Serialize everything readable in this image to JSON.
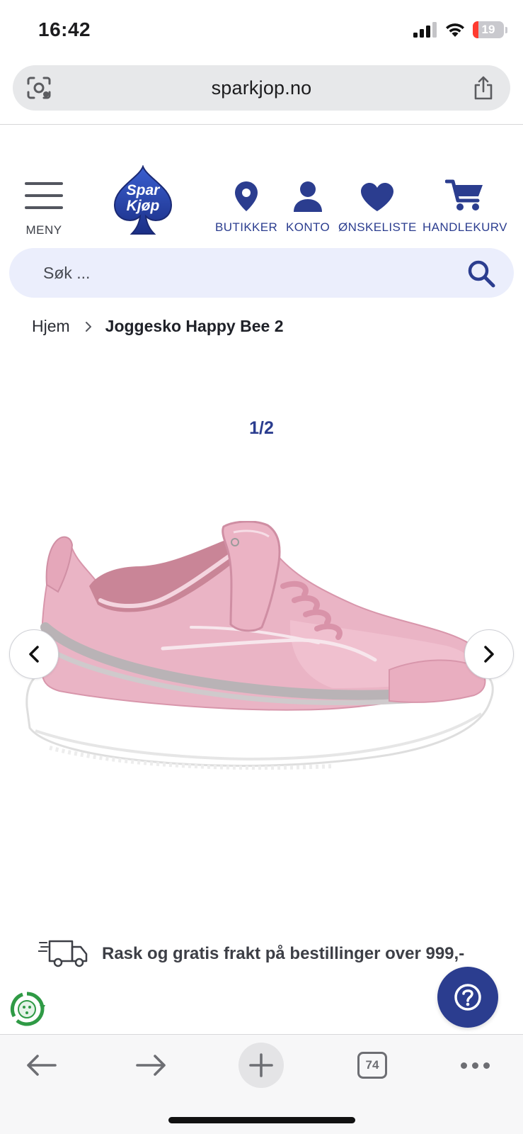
{
  "status_bar": {
    "time": "16:42",
    "battery": "19",
    "battery_level": 0.19
  },
  "browser": {
    "url": "sparkjop.no",
    "tab_count": "74"
  },
  "header": {
    "menu_label": "MENY",
    "logo_text": [
      "Spar",
      "Kjøp"
    ],
    "nav": [
      {
        "label": "BUTIKKER",
        "icon": "location-pin-icon"
      },
      {
        "label": "KONTO",
        "icon": "person-icon"
      },
      {
        "label": "ØNSKELISTE",
        "icon": "heart-icon"
      },
      {
        "label": "HANDLEKURV",
        "icon": "cart-icon"
      }
    ]
  },
  "search": {
    "placeholder": "Søk ..."
  },
  "breadcrumb": {
    "home": "Hjem",
    "current": "Joggesko Happy Bee 2"
  },
  "gallery": {
    "counter": "1/2",
    "image": "pink-velcro-sneaker"
  },
  "shipping": {
    "text": "Rask og gratis frakt på bestillinger over 999,-"
  },
  "colors": {
    "brand": "#2b3d8f",
    "search_bg": "#ebeefc",
    "shoe_pink": "#eab4c5"
  }
}
